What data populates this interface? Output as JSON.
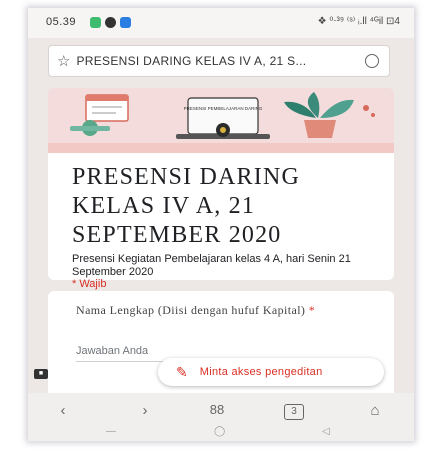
{
  "status": {
    "time": "05.39",
    "right": "❖ ⁰⋅³⁹ ⁽ˢ⁾ ᵢ.ll ⁴ᴳil ⊡4"
  },
  "url": {
    "text": "PRESENSI DARING KELAS IV A, 21 S..."
  },
  "banner": {
    "text": "PRESENSI PEMBELAJARAN DARING"
  },
  "form": {
    "title": "PRESENSI DARING KELAS IV A, 21 SEPTEMBER 2020",
    "description": "Presensi Kegiatan Pembelajaran kelas 4 A, hari Senin 21 September 2020",
    "required": "* Wajib"
  },
  "question": {
    "label": "Nama Lengkap (Diisi dengan hufuf Kapital)",
    "asterisk": "*",
    "placeholder": "Jawaban Anda"
  },
  "edit_button": {
    "label": "Minta akses pengeditan"
  },
  "navbar": {
    "back": "‹",
    "forward": "›",
    "menu": "88",
    "tabs": "3",
    "home": "⌂"
  },
  "sysbar": {
    "recent": "—",
    "home": "◯",
    "back": "◁"
  },
  "colors": {
    "accent": "#d93025",
    "banner": "#f4dcdc",
    "header_stripe": "#f2c9c5"
  }
}
